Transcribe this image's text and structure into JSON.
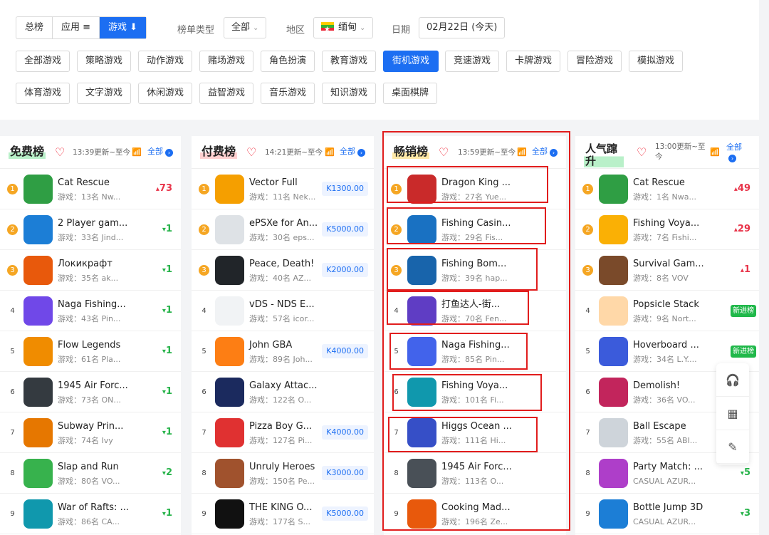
{
  "tabs": [
    {
      "label": "总榜",
      "active": false
    },
    {
      "label": "应用 ≡",
      "active": false
    },
    {
      "label": "游戏 ⬇",
      "active": true
    }
  ],
  "filters": {
    "chart_type_label": "榜单类型",
    "chart_type_value": "全部",
    "region_label": "地区",
    "region_value": "缅甸",
    "date_label": "日期",
    "date_value": "02月22日 (今天)"
  },
  "categories": [
    {
      "label": "全部游戏",
      "active": false
    },
    {
      "label": "策略游戏",
      "active": false
    },
    {
      "label": "动作游戏",
      "active": false
    },
    {
      "label": "赌场游戏",
      "active": false
    },
    {
      "label": "角色扮演",
      "active": false
    },
    {
      "label": "教育游戏",
      "active": false
    },
    {
      "label": "街机游戏",
      "active": true
    },
    {
      "label": "竞速游戏",
      "active": false
    },
    {
      "label": "卡牌游戏",
      "active": false
    },
    {
      "label": "冒险游戏",
      "active": false
    },
    {
      "label": "模拟游戏",
      "active": false
    },
    {
      "label": "体育游戏",
      "active": false
    },
    {
      "label": "文字游戏",
      "active": false
    },
    {
      "label": "休闲游戏",
      "active": false
    },
    {
      "label": "益智游戏",
      "active": false
    },
    {
      "label": "音乐游戏",
      "active": false
    },
    {
      "label": "知识游戏",
      "active": false
    },
    {
      "label": "桌面棋牌",
      "active": false
    }
  ],
  "columns": [
    {
      "title": "免费榜",
      "updated": "13:39更新~至今",
      "all": "全部",
      "items": [
        {
          "rank": "1",
          "name": "Cat Rescue",
          "sub": "游戏：13名 Nw...",
          "change": "73",
          "dir": "up"
        },
        {
          "rank": "2",
          "name": "2 Player gam...",
          "sub": "游戏：33名 Jind...",
          "change": "1",
          "dir": "dn"
        },
        {
          "rank": "3",
          "name": "Локикрафт",
          "sub": "游戏：35名 ak...",
          "change": "1",
          "dir": "dn"
        },
        {
          "rank": "4",
          "name": "Naga Fishing...",
          "sub": "游戏：43名 Pin...",
          "change": "1",
          "dir": "dn"
        },
        {
          "rank": "5",
          "name": "Flow Legends",
          "sub": "游戏：61名 Pla...",
          "change": "1",
          "dir": "dn"
        },
        {
          "rank": "6",
          "name": "1945 Air Forc...",
          "sub": "游戏：73名 ON...",
          "change": "1",
          "dir": "dn"
        },
        {
          "rank": "7",
          "name": "Subway Prin...",
          "sub": "游戏：74名 Ivy",
          "change": "1",
          "dir": "dn"
        },
        {
          "rank": "8",
          "name": "Slap and Run",
          "sub": "游戏：80名 VO...",
          "change": "2",
          "dir": "dn"
        },
        {
          "rank": "9",
          "name": "War of Rafts: ...",
          "sub": "游戏：86名 CA...",
          "change": "1",
          "dir": "dn"
        }
      ]
    },
    {
      "title": "付费榜",
      "updated": "14:21更新~至今",
      "all": "全部",
      "items": [
        {
          "rank": "1",
          "name": "Vector Full",
          "sub": "游戏：11名 Nek...",
          "price": "K1300.00"
        },
        {
          "rank": "2",
          "name": "ePSXe for An...",
          "sub": "游戏：30名 eps...",
          "price": "K5000.00"
        },
        {
          "rank": "3",
          "name": "Peace, Death!",
          "sub": "游戏：40名 AZ...",
          "price": "K2000.00"
        },
        {
          "rank": "4",
          "name": "vDS - NDS E...",
          "sub": "游戏：57名 icor...",
          "price": ""
        },
        {
          "rank": "5",
          "name": "John GBA",
          "sub": "游戏：89名 Joh...",
          "price": "K4000.00"
        },
        {
          "rank": "6",
          "name": "Galaxy Attac...",
          "sub": "游戏：122名 O...",
          "price": ""
        },
        {
          "rank": "7",
          "name": "Pizza Boy G...",
          "sub": "游戏：127名 Pi...",
          "price": "K4000.00"
        },
        {
          "rank": "8",
          "name": "Unruly Heroes",
          "sub": "游戏：150名 Pe...",
          "price": "K3000.00"
        },
        {
          "rank": "9",
          "name": "THE KING O...",
          "sub": "游戏：177名 S...",
          "price": "K5000.00"
        }
      ]
    },
    {
      "title": "畅销榜",
      "updated": "13:59更新~至今",
      "all": "全部",
      "items": [
        {
          "rank": "1",
          "name": "Dragon King ...",
          "sub": "游戏：27名 Yue..."
        },
        {
          "rank": "2",
          "name": "Fishing Casin...",
          "sub": "游戏：29名 Fis..."
        },
        {
          "rank": "3",
          "name": "Fishing Bom...",
          "sub": "游戏：39名 hap..."
        },
        {
          "rank": "4",
          "name": "打鱼达人-街...",
          "sub": "游戏：70名 Fen..."
        },
        {
          "rank": "5",
          "name": "Naga Fishing...",
          "sub": "游戏：85名 Pin..."
        },
        {
          "rank": "6",
          "name": "Fishing Voya...",
          "sub": "游戏：101名 Fi..."
        },
        {
          "rank": "7",
          "name": "Higgs Ocean ...",
          "sub": "游戏：111名 Hi..."
        },
        {
          "rank": "8",
          "name": "1945 Air Forc...",
          "sub": "游戏：113名 O..."
        },
        {
          "rank": "9",
          "name": "Cooking Mad...",
          "sub": "游戏：196名 Ze..."
        }
      ]
    },
    {
      "title": "人气蹿升",
      "updated": "13:00更新~至今",
      "all": "全部",
      "items": [
        {
          "rank": "1",
          "name": "Cat Rescue",
          "sub": "游戏：1名 Nwa...",
          "change": "49",
          "dir": "up"
        },
        {
          "rank": "2",
          "name": "Fishing Voya...",
          "sub": "游戏：7名 Fishi...",
          "change": "29",
          "dir": "up"
        },
        {
          "rank": "3",
          "name": "Survival Gam...",
          "sub": "游戏：8名 VOV",
          "change": "1",
          "dir": "up"
        },
        {
          "rank": "4",
          "name": "Popsicle Stack",
          "sub": "游戏：9名 Nort...",
          "badge": "新进榜"
        },
        {
          "rank": "5",
          "name": "Hoverboard ...",
          "sub": "游戏：34名 L.Y....",
          "badge": "新进榜"
        },
        {
          "rank": "6",
          "name": "Demolish!",
          "sub": "游戏：36名 VO..."
        },
        {
          "rank": "7",
          "name": "Ball Escape",
          "sub": "游戏：55名 ABI..."
        },
        {
          "rank": "8",
          "name": "Party Match: ...",
          "sub": "CASUAL AZUR...",
          "change": "5",
          "dir": "dn"
        },
        {
          "rank": "9",
          "name": "Bottle Jump 3D",
          "sub": "CASUAL AZUR...",
          "change": "3",
          "dir": "dn"
        }
      ]
    }
  ],
  "icon_colors": [
    [
      "#2f9e44",
      "#1c7ed6",
      "#e8590c",
      "#7048e8",
      "#f08c00",
      "#343a40",
      "#e67700",
      "#37b24d",
      "#1098ad"
    ],
    [
      "#f59f00",
      "#dee2e6",
      "#212529",
      "#f1f3f5",
      "#fd7e14",
      "#1b2a5e",
      "#e03131",
      "#a0522d",
      "#111111"
    ],
    [
      "#c92a2a",
      "#1971c2",
      "#1864ab",
      "#5f3dc4",
      "#4263eb",
      "#1098ad",
      "#364fc7",
      "#495057",
      "#e8590c"
    ],
    [
      "#2f9e44",
      "#fab005",
      "#7a4a2a",
      "#ffd8a8",
      "#3b5bdb",
      "#c2255c",
      "#ced4da",
      "#ae3ec9",
      "#1c7ed6"
    ]
  ],
  "float_icons": [
    "headset-icon",
    "qrcode-icon",
    "feedback-icon"
  ],
  "accent": "#1c6ef2"
}
